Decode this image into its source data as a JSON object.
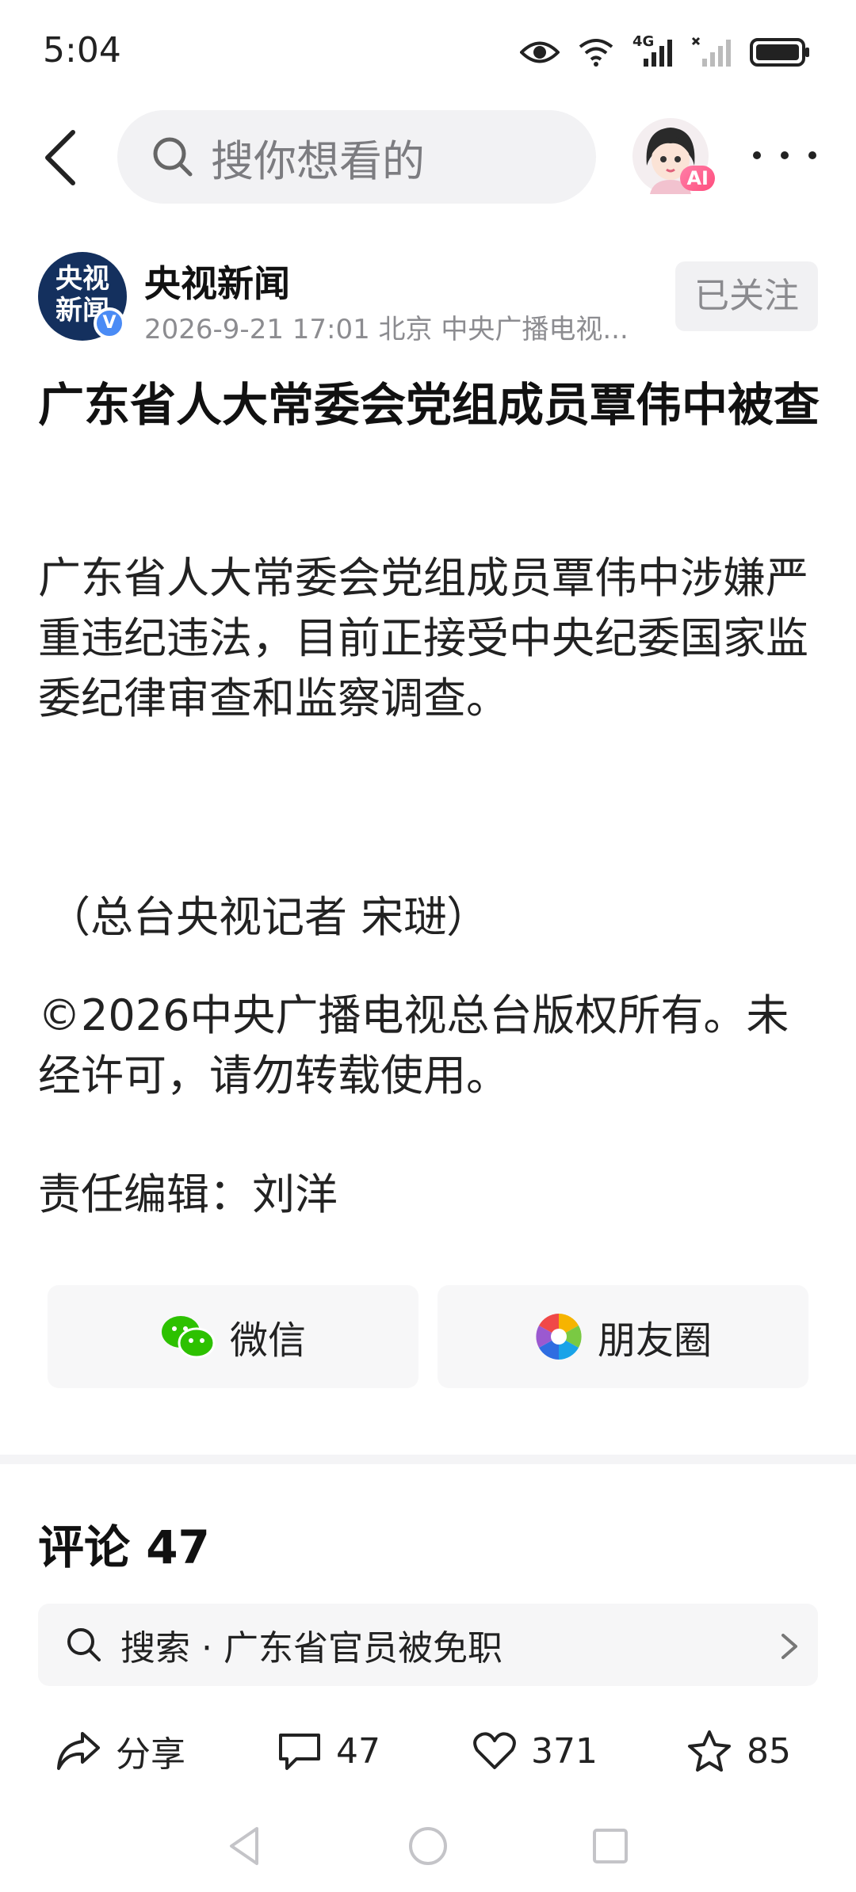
{
  "status": {
    "time": "5:04",
    "network_label": "4G"
  },
  "top_bar": {
    "search_placeholder": "搜你想看的",
    "ai_badge": "AI"
  },
  "author": {
    "logo_line1": "央视",
    "logo_line2": "新闻",
    "verified_mark": "V",
    "name": "央视新闻",
    "meta": "2026-9-21  17:01  北京  中央广播电视...",
    "follow_label": "已关注"
  },
  "article": {
    "title": "广东省人大常委会党组成员覃伟中被查",
    "paragraph1": "广东省人大常委会党组成员覃伟中涉嫌严重违纪违法，目前正接受中央纪委国家监委纪律审查和监察调查。",
    "reporter": "（总台央视记者 宋琎）",
    "copyright": "©2026中央广播电视总台版权所有。未经许可，请勿转载使用。",
    "editor": "责任编辑：刘洋"
  },
  "share": {
    "wechat_label": "微信",
    "moments_label": "朋友圈"
  },
  "comments": {
    "title": "评论 47",
    "search_text": "搜索 · 广东省官员被免职"
  },
  "actions": {
    "share_label": "分享",
    "comment_count": "47",
    "like_count": "371",
    "favorite_count": "85"
  },
  "colors": {
    "wechat_green": "#2dc100",
    "verified_blue": "#4a8bf5",
    "logo_navy": "#14305e"
  }
}
